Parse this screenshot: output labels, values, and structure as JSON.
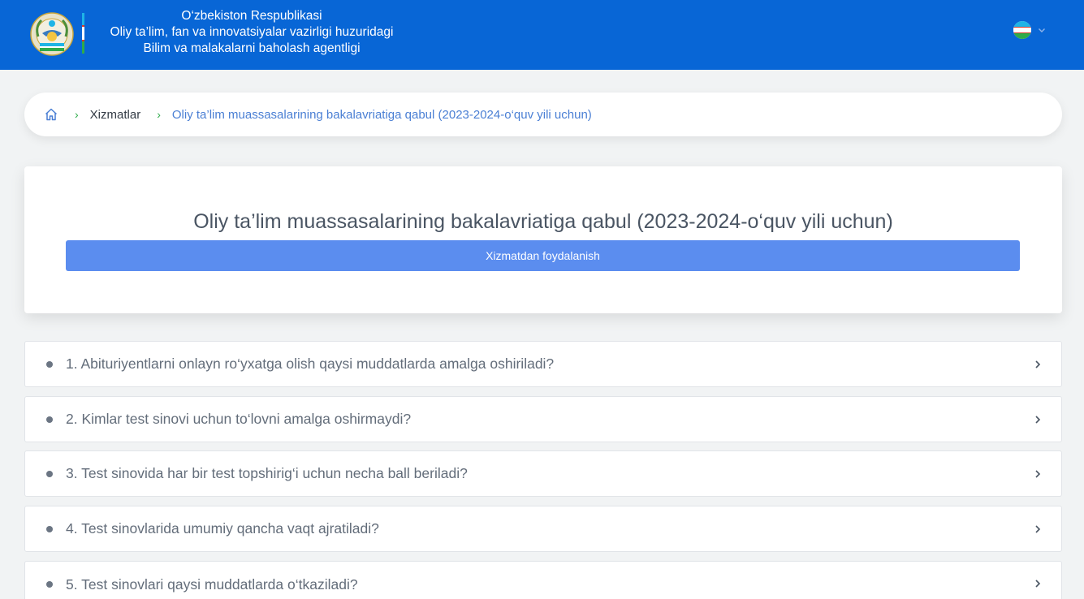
{
  "header": {
    "agency_lines": [
      "O‘zbekiston Respublikasi",
      "Oliy ta’lim, fan va innovatsiyalar vazirligi huzuridagi",
      "Bilim va malakalarni baholash agentligi"
    ],
    "emblem_icon": "uzbekistan-state-emblem",
    "language_icon": "uzbekistan-flag-icon"
  },
  "breadcrumb": {
    "home_icon": "home-icon",
    "items": [
      "Xizmatlar",
      "Oliy ta’lim muassasalarining bakalavriatiga qabul (2023-2024-o‘quv yili uchun)"
    ],
    "separator": "›"
  },
  "service": {
    "title": "Oliy ta’lim muassasalarining bakalavriatiga qabul (2023-2024-o‘quv yili uchun)",
    "button_label": "Xizmatdan foydalanish"
  },
  "faq": [
    "1. Abituriyentlarni onlayn ro‘yxatga olish qaysi muddatlarda amalga oshiriladi?",
    "2. Kimlar test sinovi uchun to‘lovni amalga oshirmaydi?",
    "3. Test sinovida har bir test topshirig‘i uchun necha ball beriladi?",
    "4. Test sinovlarida umumiy qancha vaqt ajratiladi?",
    "5. Test sinovlari qaysi muddatlarda o‘tkaziladi?"
  ],
  "colors": {
    "header_bg": "#0866d6",
    "primary_button": "#5b8def",
    "breadcrumb_active": "#4a7fd4",
    "separator": "#2eab4a"
  }
}
